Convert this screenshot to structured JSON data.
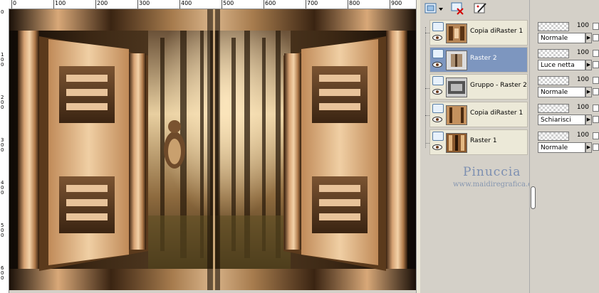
{
  "ruler_top": {
    "labels": [
      "0",
      "100",
      "200",
      "300",
      "400",
      "500",
      "600",
      "700",
      "800",
      "900"
    ]
  },
  "ruler_left": {
    "labels": [
      "0",
      "100",
      "200",
      "300",
      "400",
      "500",
      "600"
    ]
  },
  "layers_toolbar": {
    "new_layer_icon": "new-raster-layer-icon",
    "delete_icon": "delete-layer-icon",
    "edit_icon": "layer-edit-icon"
  },
  "layers": [
    {
      "name": "Copia diRaster 1",
      "selected": false
    },
    {
      "name": "Raster 2",
      "selected": true
    },
    {
      "name": "Gruppo - Raster 2",
      "selected": false
    },
    {
      "name": "Copia diRaster 1",
      "selected": false
    },
    {
      "name": "Raster 1",
      "selected": false
    }
  ],
  "properties": [
    {
      "opacity": "100",
      "blend_mode": "Normale"
    },
    {
      "opacity": "100",
      "blend_mode": "Luce netta"
    },
    {
      "opacity": "100",
      "blend_mode": "Normale"
    },
    {
      "opacity": "100",
      "blend_mode": "Schiarisci"
    },
    {
      "opacity": "100",
      "blend_mode": "Normale"
    }
  ],
  "watermark": {
    "name": "Pinuccia",
    "site": "www.maidiregrafica.eu"
  },
  "colors": {
    "selected_layer": "#7d96bf",
    "panel_bg": "#d4d0c8",
    "watermark": "#7c8fb1"
  }
}
